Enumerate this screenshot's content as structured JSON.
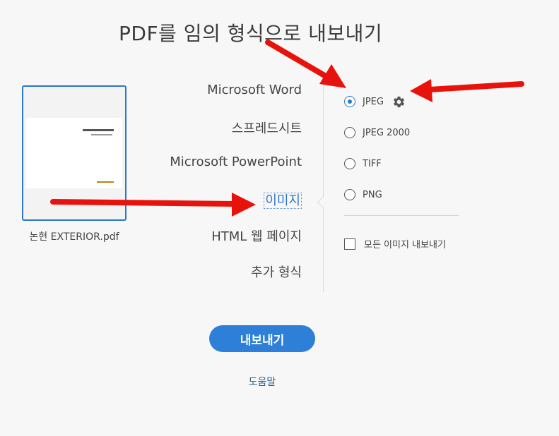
{
  "dialog": {
    "title": "PDF를 임의 형식으로 내보내기"
  },
  "file": {
    "name": "논현 EXTERIOR.pdf"
  },
  "formats": [
    {
      "id": "word",
      "label": "Microsoft Word"
    },
    {
      "id": "spreadsheet",
      "label": "스프레드시트"
    },
    {
      "id": "powerpoint",
      "label": "Microsoft PowerPoint"
    },
    {
      "id": "image",
      "label": "이미지"
    },
    {
      "id": "html",
      "label": "HTML 웹 페이지"
    },
    {
      "id": "more",
      "label": "추가 형식"
    }
  ],
  "selected_format": "이미지",
  "image_options": [
    {
      "label": "JPEG",
      "checked": true,
      "has_settings": true
    },
    {
      "label": "JPEG 2000",
      "checked": false
    },
    {
      "label": "TIFF",
      "checked": false
    },
    {
      "label": "PNG",
      "checked": false
    }
  ],
  "export_all_images": {
    "label": "모든 이미지 내보내기",
    "checked": false
  },
  "buttons": {
    "export": "내보내기",
    "help": "도움말"
  },
  "icons": {
    "settings": "gear-icon"
  },
  "colors": {
    "accent": "#2d7fd7",
    "arrow": "#e8120c"
  }
}
